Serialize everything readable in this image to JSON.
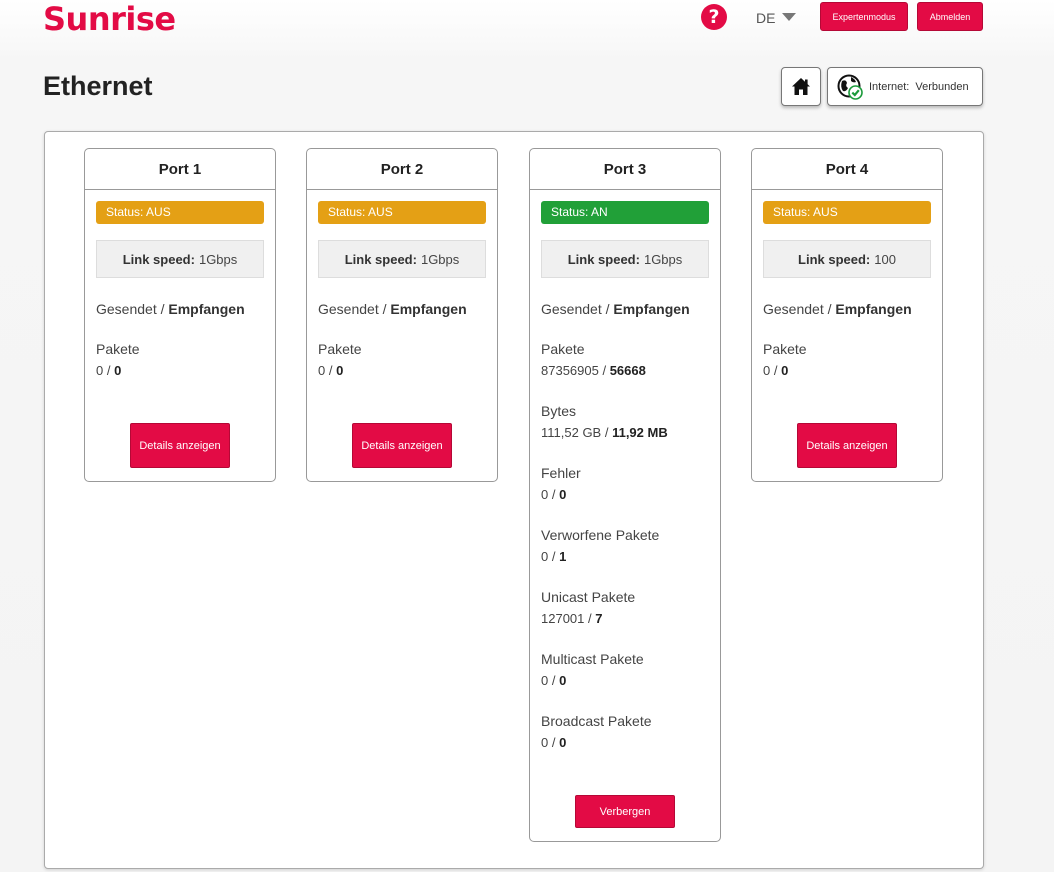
{
  "header": {
    "logo": "Sunrise",
    "help_icon": "question-circle-icon",
    "language": "DE",
    "expert_mode_label": "Expertenmodus",
    "logout_label": "Abmelden"
  },
  "page": {
    "title": "Ethernet",
    "home_icon": "home-icon",
    "internet_label": "Internet:",
    "internet_status": "Verbunden",
    "internet_icon": "globe-check-icon"
  },
  "colors": {
    "brand": "#e30b45",
    "status_off": "#e4a015",
    "status_on": "#21a038"
  },
  "ports": [
    {
      "title": "Port 1",
      "status": "Status: AUS",
      "link_speed_label": "Link speed:",
      "link_speed_value": "1Gbps",
      "sent_label": "Gesendet /",
      "recv_label": "Empfangen",
      "pakete_label": "Pakete",
      "pakete_sent": "0 /",
      "pakete_recv": "0",
      "button": "Details anzeigen"
    },
    {
      "title": "Port 2",
      "status": "Status: AUS",
      "link_speed_label": "Link speed:",
      "link_speed_value": "1Gbps",
      "sent_label": "Gesendet /",
      "recv_label": "Empfangen",
      "pakete_label": "Pakete",
      "pakete_sent": "0 /",
      "pakete_recv": "0",
      "button": "Details anzeigen"
    },
    {
      "title": "Port 3",
      "status": "Status: AN",
      "link_speed_label": "Link speed:",
      "link_speed_value": "1Gbps",
      "sent_label": "Gesendet /",
      "recv_label": "Empfangen",
      "stats": [
        {
          "label": "Pakete",
          "sent": "87356905 /",
          "recv": "56668"
        },
        {
          "label": "Bytes",
          "sent": "111,52 GB /",
          "recv": "11,92 MB"
        },
        {
          "label": "Fehler",
          "sent": "0 /",
          "recv": "0"
        },
        {
          "label": "Verworfene Pakete",
          "sent": "0 /",
          "recv": "1"
        },
        {
          "label": "Unicast Pakete",
          "sent": "127001 /",
          "recv": "7"
        },
        {
          "label": "Multicast Pakete",
          "sent": "0 /",
          "recv": "0"
        },
        {
          "label": "Broadcast Pakete",
          "sent": "0 /",
          "recv": "0"
        }
      ],
      "button": "Verbergen"
    },
    {
      "title": "Port 4",
      "status": "Status: AUS",
      "link_speed_label": "Link speed:",
      "link_speed_value": "100",
      "sent_label": "Gesendet /",
      "recv_label": "Empfangen",
      "pakete_label": "Pakete",
      "pakete_sent": "0 /",
      "pakete_recv": "0",
      "button": "Details anzeigen"
    }
  ]
}
